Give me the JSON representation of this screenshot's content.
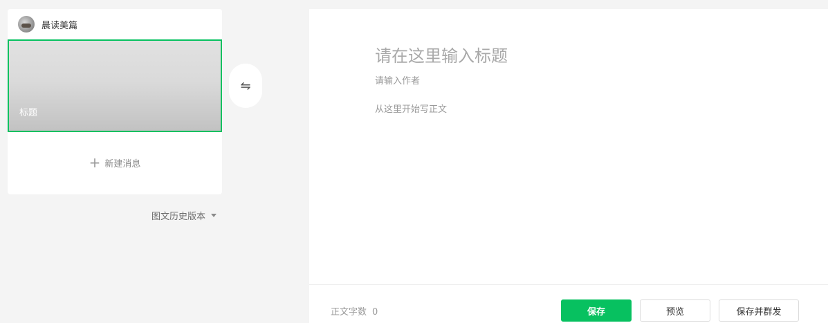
{
  "account": {
    "name": "晨读美篇"
  },
  "cover": {
    "title": "标题"
  },
  "new_message": {
    "icon": "plus-icon",
    "label": "新建消息"
  },
  "history": {
    "label": "图文历史版本"
  },
  "swap": {
    "glyph": "⇋"
  },
  "editor": {
    "title_placeholder": "请在这里输入标题",
    "author_placeholder": "请输入作者",
    "body_placeholder": "从这里开始写正文"
  },
  "footer": {
    "word_count_label": "正文字数",
    "word_count_value": "0",
    "save_label": "保存",
    "preview_label": "预览",
    "save_send_label": "保存并群发"
  },
  "colors": {
    "accent": "#07c160",
    "background": "#f4f4f4"
  }
}
